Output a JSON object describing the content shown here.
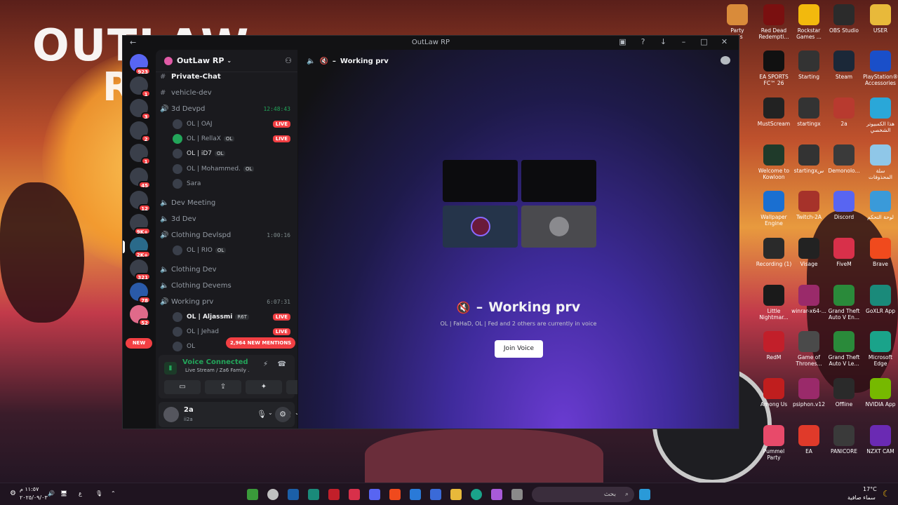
{
  "background": {
    "title_line1": "OUTLAW",
    "title_line2": "R"
  },
  "window": {
    "title": "OutLaw RP"
  },
  "server": {
    "name": "OutLaw RP",
    "badges": [
      "923",
      "1",
      "3",
      "2",
      "1",
      "45",
      "12",
      "9K+",
      "2K+",
      "321",
      "78",
      "52"
    ],
    "new_label": "NEW"
  },
  "channels": {
    "private_chat": "Private-Chat",
    "vehicle_dev": "vehicle-dev",
    "devpd": {
      "name": "3d Devpd",
      "time": "12:48:43"
    },
    "devpd_users": [
      {
        "name": "OL | OAJ",
        "tag": "",
        "live": "LIVE"
      },
      {
        "name": "OL | RellaX",
        "tag": "OL",
        "live": "LIVE"
      },
      {
        "name": "OL | iD7",
        "tag": "OL",
        "live": ""
      },
      {
        "name": "OL | Mohammed.",
        "tag": "OL",
        "live": ""
      },
      {
        "name": "Sara",
        "tag": "",
        "live": ""
      }
    ],
    "dev_meeting": "Dev Meeting",
    "dev3d": "3d Dev",
    "clothing_devlspd": {
      "name": "Clothing Devlspd",
      "time": "1:00:16"
    },
    "clothing_users": [
      {
        "name": "OL | RIO",
        "tag": "OL"
      }
    ],
    "clothing_dev": "Clothing Dev",
    "clothing_devems": "Clothing Devems",
    "working_prv": {
      "name": "Working prv",
      "time": "6:07:31"
    },
    "working_users": [
      {
        "name": "OL | Aljassmi",
        "tag": "R6T",
        "live": "LIVE"
      },
      {
        "name": "OL | Jehad",
        "tag": "",
        "live": "LIVE"
      },
      {
        "name": "OL",
        "tag": "",
        "live": ""
      }
    ],
    "mentions": "2,964 NEW MENTIONS"
  },
  "voice": {
    "status": "Voice Connected",
    "sub": "Live Stream / Za6 Family ."
  },
  "user": {
    "name": "2a",
    "status": "ii2a"
  },
  "main": {
    "header": "Working prv",
    "title": "Working prv",
    "subtitle": "OL | FaHaD, OL | Fed and 2 others are currently in voice",
    "join": "Join Voice"
  },
  "desktop_icons": [
    {
      "label": "Party\nnals",
      "color": "#d98b3a"
    },
    {
      "label": "Red Dead\nRedempti...",
      "color": "#7a1010"
    },
    {
      "label": "Rockstar\nGames ...",
      "color": "#f2b90d"
    },
    {
      "label": "OBS Studio",
      "color": "#2b2b2b"
    },
    {
      "label": "USER",
      "color": "#e8b93a"
    },
    {
      "label": "EA SPORTS\nFC™ 26",
      "color": "#111111"
    },
    {
      "label": "Starting",
      "color": "#333333"
    },
    {
      "label": "Steam",
      "color": "#1b2838"
    },
    {
      "label": "PlayStation®\nAccessories",
      "color": "#1a4fc9"
    },
    {
      "label": "MustScream",
      "color": "#222222"
    },
    {
      "label": "startingx",
      "color": "#333333"
    },
    {
      "label": "2a",
      "color": "#b83a2f"
    },
    {
      "label": "هذا الكمبيوتر\nالشخصي",
      "color": "#2aa7d8"
    },
    {
      "label": "Welcome to\nKowloon",
      "color": "#1f3a2a"
    },
    {
      "label": "startingxس",
      "color": "#333333"
    },
    {
      "label": "Demonolo...",
      "color": "#3a3a3a"
    },
    {
      "label": "سلة\nالمحذوفات",
      "color": "#8fc7e8"
    },
    {
      "label": "Wallpaper\nEngine",
      "color": "#1a6fd1"
    },
    {
      "label": "Twitch-2A",
      "color": "#a6322a"
    },
    {
      "label": "Discord",
      "color": "#5865f2"
    },
    {
      "label": "لوحة التحكم",
      "color": "#3a9ad9"
    },
    {
      "label": "Recording (1)",
      "color": "#2a2a2a"
    },
    {
      "label": "Visage",
      "color": "#222222"
    },
    {
      "label": "FiveM",
      "color": "#d8304a"
    },
    {
      "label": "Brave",
      "color": "#f04a1d"
    },
    {
      "label": "Little\nNightmar...",
      "color": "#1a1a1a"
    },
    {
      "label": "winrar-x64-...",
      "color": "#9a2a6a"
    },
    {
      "label": "Grand Theft\nAuto V En...",
      "color": "#2a8a3a"
    },
    {
      "label": "GoXLR App",
      "color": "#1a8a7a"
    },
    {
      "label": "RedM",
      "color": "#c21f2a"
    },
    {
      "label": "Game of\nThrones...",
      "color": "#4a4a4a"
    },
    {
      "label": "Grand Theft\nAuto V Le...",
      "color": "#2a8a3a"
    },
    {
      "label": "Microsoft\nEdge",
      "color": "#1aa38a"
    },
    {
      "label": "Among Us",
      "color": "#c01e1e"
    },
    {
      "label": "psiphon.v12",
      "color": "#9a2a6a"
    },
    {
      "label": "Offline",
      "color": "#2a2a2a"
    },
    {
      "label": "NVIDIA App",
      "color": "#76b900"
    },
    {
      "label": "Pummel\nParty",
      "color": "#e84a6a"
    },
    {
      "label": "EA",
      "color": "#e03a2a"
    },
    {
      "label": "PANICORE",
      "color": "#3a3a3a"
    },
    {
      "label": "NZXT CAM",
      "color": "#6a2ab3"
    }
  ],
  "taskbar": {
    "search": "بحث",
    "weather_temp": "17°C",
    "weather_text": "سماء صافية",
    "time": "١١:٥٧ م",
    "date": "٢٠٢٥/٠٩/٠٣",
    "lang": "ع"
  }
}
